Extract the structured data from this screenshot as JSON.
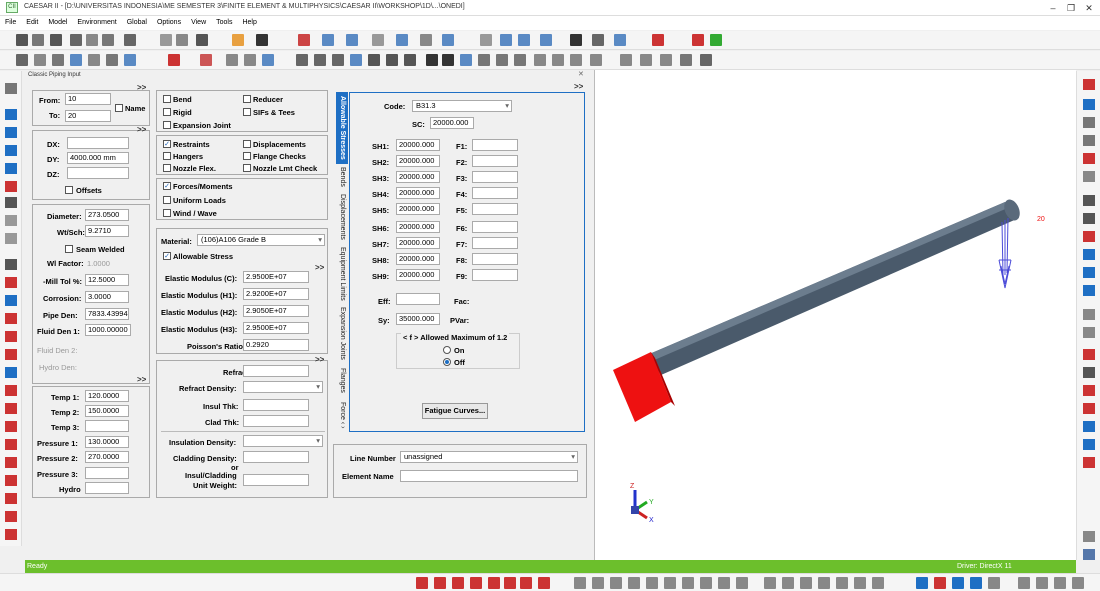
{
  "window": {
    "title": "CAESAR II - [D:\\UNIVERSITAS INDONESIA\\ME SEMESTER 3\\FINITE ELEMENT & MULTIPHYSICS\\CAESAR II\\WORKSHOP\\1D\\...\\ONEDI]",
    "app_icon": "CII"
  },
  "menu": [
    "File",
    "Edit",
    "Model",
    "Environment",
    "Global",
    "Options",
    "View",
    "Tools",
    "Help"
  ],
  "panel_title": "Classic Piping Input",
  "expand_glyph": ">>",
  "nodes": {
    "from_label": "From:",
    "from_value": "10",
    "to_label": "To:",
    "to_value": "20",
    "name_label": "Name"
  },
  "deltas": {
    "dx_label": "DX:",
    "dx_value": "",
    "dy_label": "DY:",
    "dy_value": "4000.000 mm",
    "dz_label": "DZ:",
    "dz_value": "",
    "offsets_label": "Offsets"
  },
  "pipe": {
    "diameter_label": "Diameter:",
    "diameter_value": "273.0500",
    "wt_label": "Wt/Sch:",
    "wt_value": "9.2710",
    "seam_label": "Seam Welded",
    "wfactor_label": "Wl Factor:",
    "wfactor_value": "1.0000",
    "mill_label": "-Mill Tol %:",
    "mill_value": "12.5000",
    "corr_label": "Corrosion:",
    "corr_value": "3.0000",
    "pipeden_label": "Pipe Den:",
    "pipeden_value": "7833.43994",
    "fluid1_label": "Fluid Den 1:",
    "fluid1_value": "1000.00000",
    "fluid2_label": "Fluid Den 2:",
    "hydroden_label": "Hydro Den:"
  },
  "operating": {
    "t1_label": "Temp 1:",
    "t1_value": "120.0000",
    "t2_label": "Temp 2:",
    "t2_value": "150.0000",
    "t3_label": "Temp 3:",
    "p1_label": "Pressure 1:",
    "p1_value": "130.0000",
    "p2_label": "Pressure 2:",
    "p2_value": "270.0000",
    "p3_label": "Pressure 3:",
    "hydro_label": "Hydro"
  },
  "element_checks": {
    "bend": "Bend",
    "reducer": "Reducer",
    "rigid": "Rigid",
    "sifs": "SIFs & Tees",
    "expjoint": "Expansion Joint"
  },
  "aux_checks": {
    "restraints": "Restraints",
    "displacements": "Displacements",
    "hangers": "Hangers",
    "flangechecks": "Flange Checks",
    "nozzleflex": "Nozzle Flex.",
    "nozzlelmt": "Nozzle Lmt Check"
  },
  "load_checks": {
    "forces": "Forces/Moments",
    "uniform": "Uniform Loads",
    "wind": "Wind / Wave"
  },
  "material": {
    "label": "Material:",
    "value": "(106)A106 Grade B",
    "allow_label": "Allowable Stress",
    "ec_label": "Elastic Modulus (C):",
    "ec_value": "2.9500E+07",
    "eh1_label": "Elastic Modulus (H1):",
    "eh1_value": "2.9200E+07",
    "eh2_label": "Elastic Modulus (H2):",
    "eh2_value": "2.9050E+07",
    "eh3_label": "Elastic Modulus (H3):",
    "eh3_value": "2.9500E+07",
    "poisson_label": "Poisson's Ratio:",
    "poisson_value": "0.2920"
  },
  "insulation": {
    "refract_thk": "Refract Thk:",
    "refract_den": "Refract Density:",
    "insul_thk": "Insul Thk:",
    "clad_thk": "Clad Thk:",
    "insul_den": "Insulation Density:",
    "clad_den": "Cladding Density:",
    "or": "or",
    "insul_clad": "Insul/Cladding",
    "unit_weight": "Unit Weight:"
  },
  "tabs": [
    "Allowable Stresses",
    "Bends",
    "Displacements",
    "Equipment Limits",
    "Expansion Joints",
    "Flanges",
    "Force ‹ ›"
  ],
  "allowables": {
    "code_label": "Code:",
    "code_value": "B31.3",
    "sc_label": "SC:",
    "sc_value": "20000.000",
    "sh": [
      {
        "label": "SH1:",
        "value": "20000.000"
      },
      {
        "label": "SH2:",
        "value": "20000.000"
      },
      {
        "label": "SH3:",
        "value": "20000.000"
      },
      {
        "label": "SH4:",
        "value": "20000.000"
      },
      {
        "label": "SH5:",
        "value": "20000.000"
      },
      {
        "label": "SH6:",
        "value": "20000.000"
      },
      {
        "label": "SH7:",
        "value": "20000.000"
      },
      {
        "label": "SH8:",
        "value": "20000.000"
      },
      {
        "label": "SH9:",
        "value": "20000.000"
      }
    ],
    "f": [
      "F1:",
      "F2:",
      "F3:",
      "F4:",
      "F5:",
      "F6:",
      "F7:",
      "F8:",
      "F9:"
    ],
    "eff_label": "Eff:",
    "fac_label": "Fac:",
    "sy_label": "Sy:",
    "sy_value": "35000.000",
    "pvar_label": "PVar:",
    "fmax_label": "< f > Allowed Maximum of 1.2",
    "on_label": "On",
    "off_label": "Off",
    "fatigue_button": "Fatigue Curves..."
  },
  "line": {
    "line_number_label": "Line Number",
    "line_number_value": "unassigned",
    "element_name_label": "Element Name",
    "element_name_value": ""
  },
  "viewport": {
    "node_label": "20",
    "axis_z": "Z",
    "axis_y": "Y",
    "axis_x": "X",
    "pipe_color": "#4a5a6b",
    "restraint_color": "#ee1111",
    "force_color": "#4b4bd8"
  },
  "status": {
    "left": "Ready",
    "driver": "Driver: DirectX 11"
  }
}
